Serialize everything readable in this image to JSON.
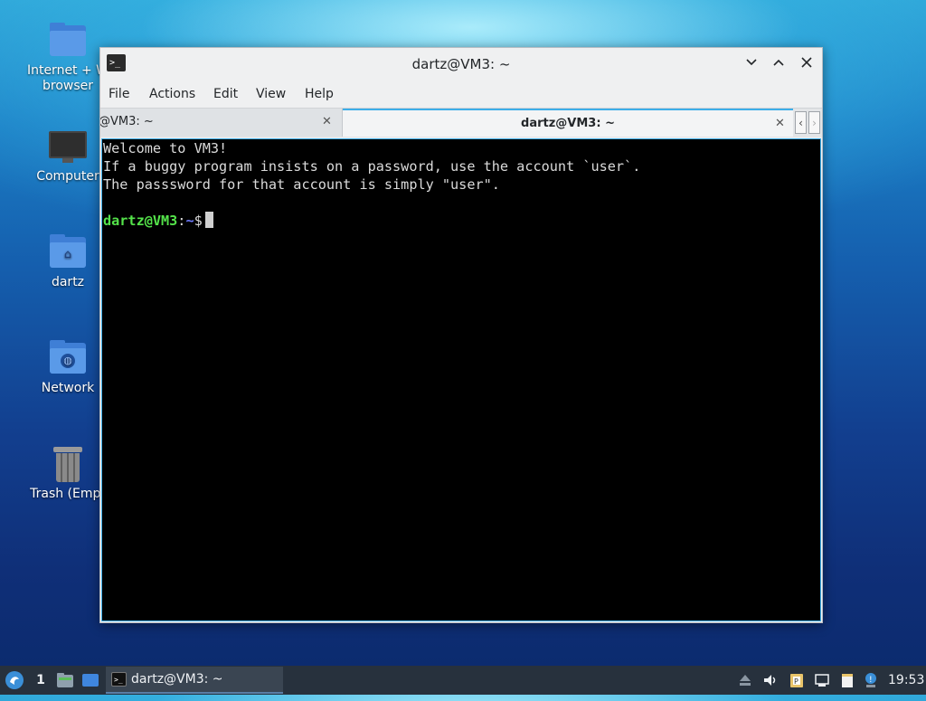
{
  "desktop": {
    "icons": [
      {
        "label": "Internet + W\nbrowser",
        "line1": "Internet + W",
        "line2": "browser"
      },
      {
        "label": "Computer"
      },
      {
        "label": "dartz"
      },
      {
        "label": "Network"
      },
      {
        "label": "Trash (Empt"
      }
    ]
  },
  "window": {
    "title": "dartz@VM3: ~",
    "menu": [
      "File",
      "Actions",
      "Edit",
      "View",
      "Help"
    ],
    "tabs": [
      {
        "label": "@VM3: ~",
        "active": false
      },
      {
        "label": "dartz@VM3: ~",
        "active": true
      }
    ],
    "tab_close_glyph": "✕",
    "controls": {
      "minimize": "⌄",
      "maximize": "⌃",
      "close": "✕"
    }
  },
  "terminal": {
    "lines": [
      "Welcome to VM3!",
      "If a buggy program insists on a password, use the account `user`.",
      "The passsword for that account is simply \"user\".",
      ""
    ],
    "prompt_user": "dartz@VM3",
    "prompt_sep": ":",
    "prompt_path": "~",
    "prompt_symbol": "$",
    "colors": {
      "background": "#000000",
      "text": "#dadada",
      "user": "#54e34a",
      "path": "#6f7cff"
    }
  },
  "taskbar": {
    "workspace": "1",
    "task_label": "dartz@VM3: ~",
    "clock": "19:53"
  }
}
